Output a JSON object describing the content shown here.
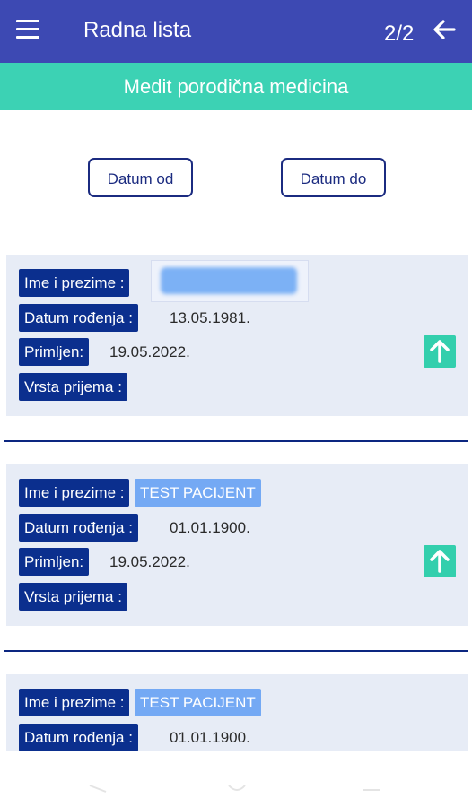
{
  "header": {
    "title": "Radna lista",
    "pager": "2/2"
  },
  "subheader": {
    "text": "Medit porodična medicina"
  },
  "filters": {
    "date_from": "Datum od",
    "date_to": "Datum do"
  },
  "labels": {
    "name": "Ime i prezime :",
    "dob": "Datum rođenja :",
    "admitted": "Primljen:",
    "type": "Vrsta prijema :"
  },
  "records": [
    {
      "name": "",
      "dob": "13.05.1981.",
      "admitted": "19.05.2022.",
      "type": ""
    },
    {
      "name": "TEST PACIJENT",
      "dob": "01.01.1900.",
      "admitted": "19.05.2022.",
      "type": ""
    },
    {
      "name": "TEST PACIJENT",
      "dob": "01.01.1900."
    }
  ],
  "colors": {
    "header": "#3d49b3",
    "subheader": "#3cd2b4",
    "label_bg": "#0b2f8e",
    "name_chip": "#74a9f4",
    "up_button": "#33cfad"
  }
}
